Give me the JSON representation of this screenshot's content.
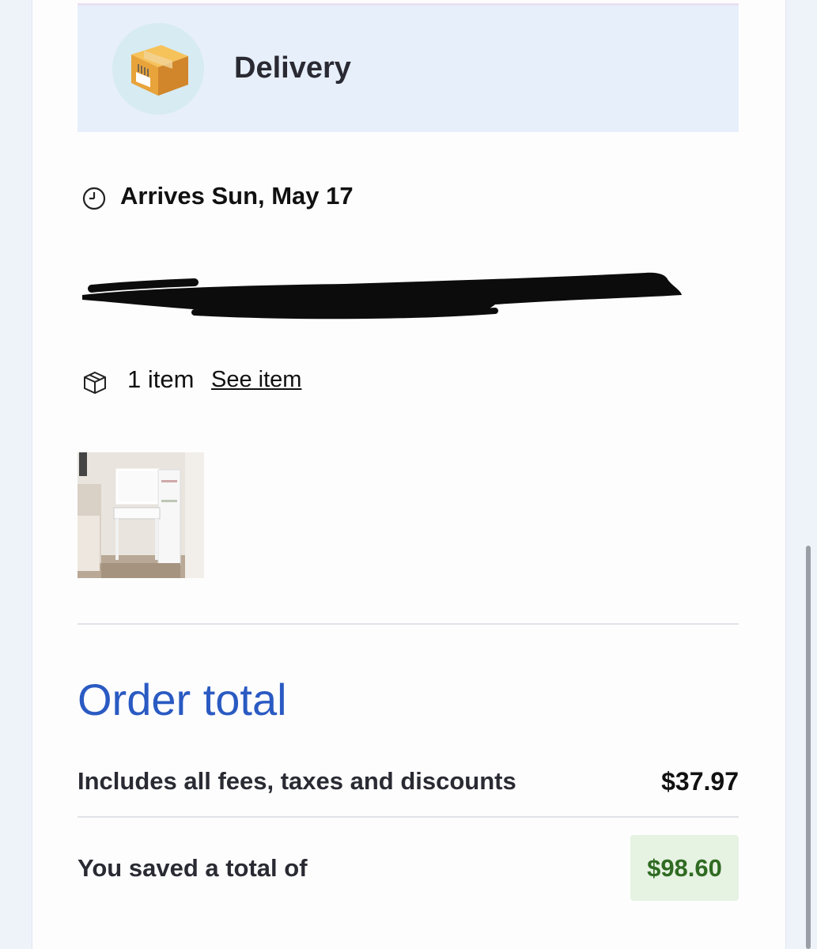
{
  "delivery": {
    "title": "Delivery",
    "icon": "package-icon"
  },
  "arrival": {
    "text": "Arrives Sun, May 17",
    "icon": "clock-icon"
  },
  "address": {
    "text": "",
    "icon": "location-icon",
    "redacted": true
  },
  "items": {
    "count_text": "1 item",
    "link": "See item",
    "icon": "box-icon"
  },
  "order_total": {
    "title": "Order total",
    "fees_label": "Includes all fees, taxes and discounts",
    "fees_value": "$37.97",
    "saved_label": "You saved a total of",
    "saved_value": "$98.60"
  },
  "colors": {
    "accent": "#2a5ac2",
    "saved_bg": "#e6f2e2",
    "saved_text": "#2f6b22",
    "header_bg": "#e7effb"
  }
}
